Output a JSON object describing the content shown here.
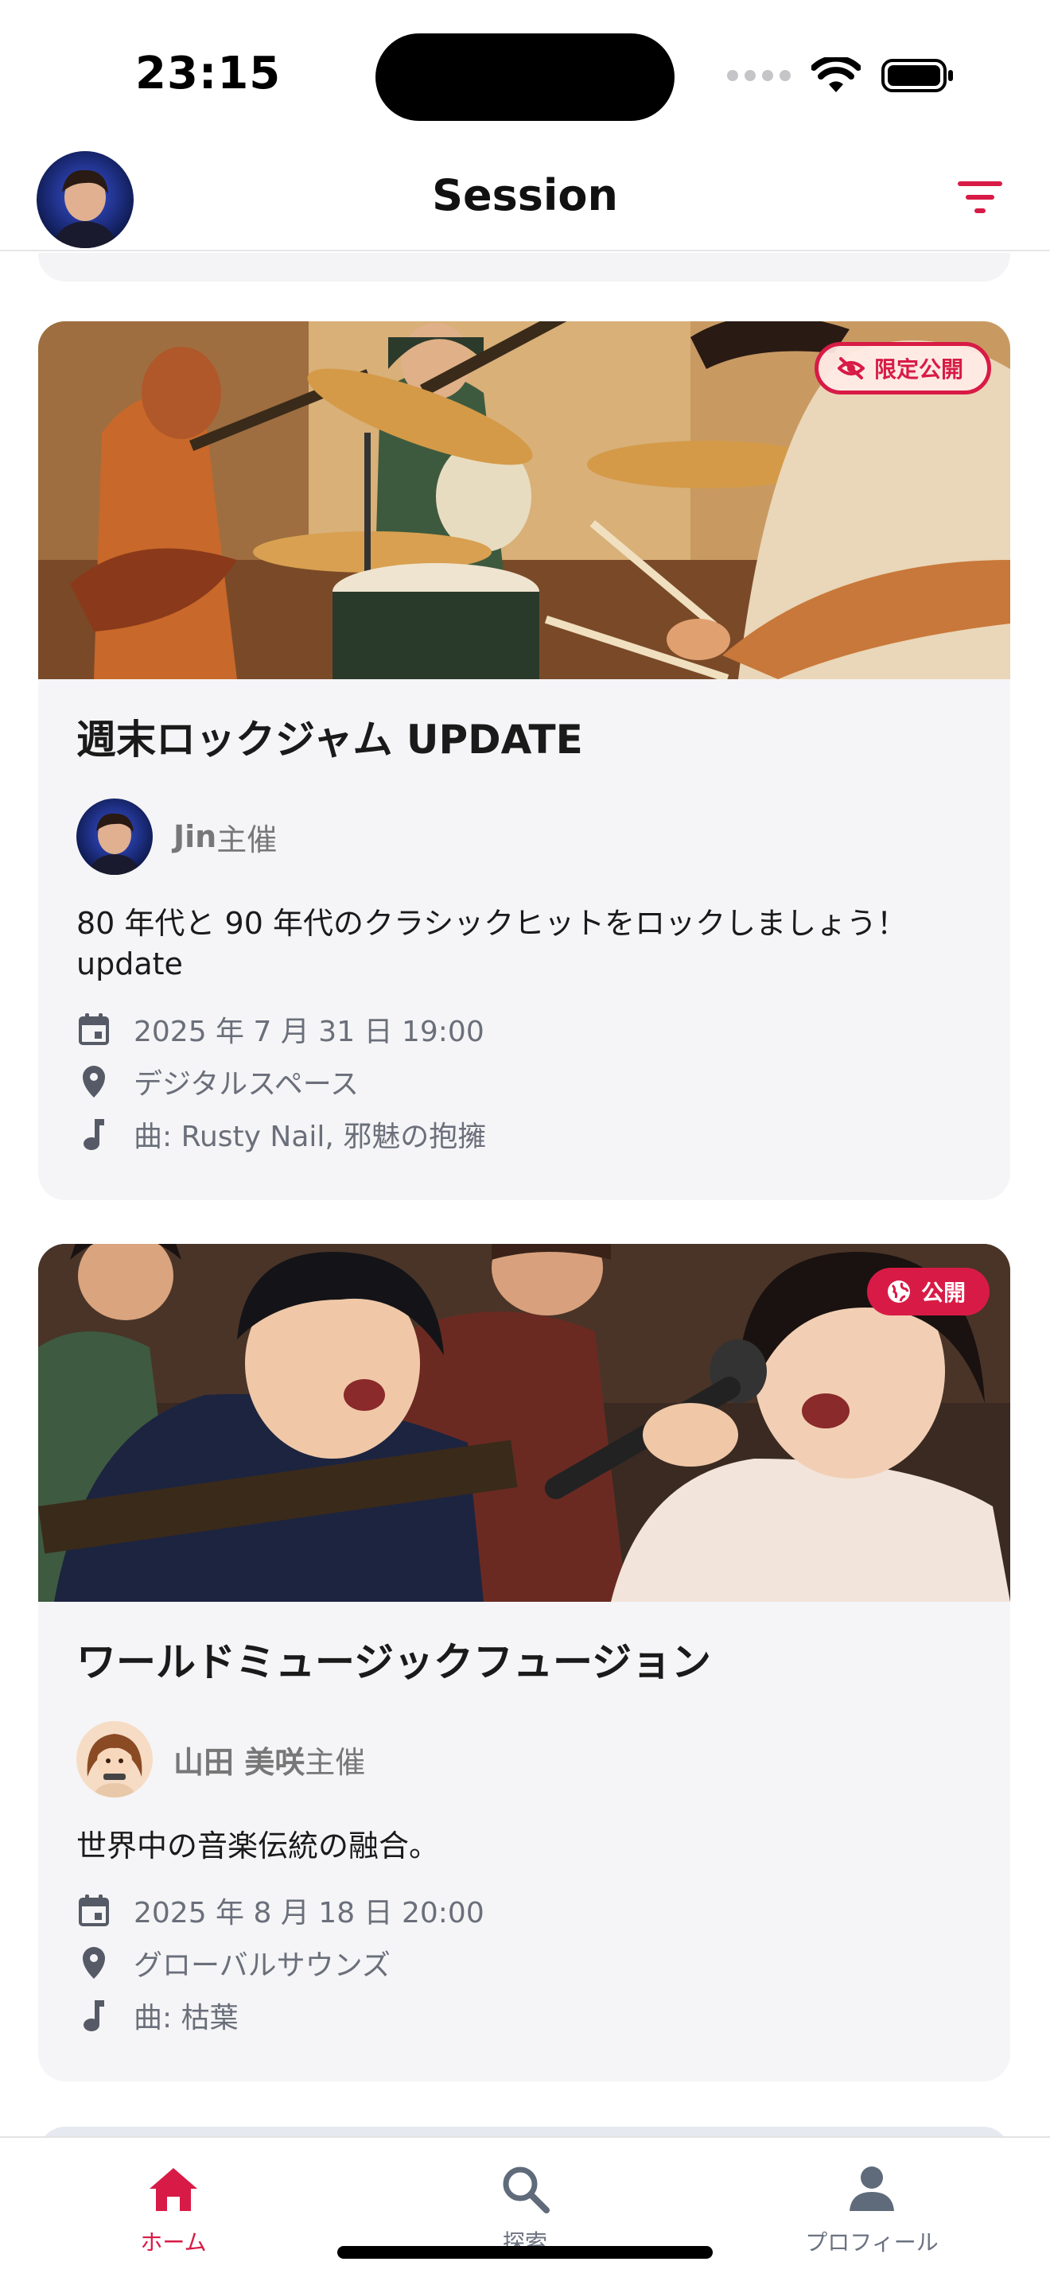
{
  "status_bar": {
    "time": "23:15"
  },
  "header": {
    "title": "Session"
  },
  "cards": [
    {
      "badge": "限定公開",
      "title": "週末ロックジャム UPDATE",
      "host_name": "Jin",
      "host_suffix": "主催",
      "description": "80 年代と 90 年代のクラシックヒットをロックしましょう！ update",
      "date": "2025 年 7 月 31 日 19:00",
      "location": "デジタルスペース",
      "songs": "曲: Rusty Nail, 邪魅の抱擁"
    },
    {
      "badge": "公開",
      "title": "ワールドミュージックフュージョン",
      "host_name": "山田 美咲",
      "host_suffix": "主催",
      "description": "世界中の音楽伝統の融合。",
      "date": "2025 年 8 月 18 日 20:00",
      "location": "グローバルサウンズ",
      "songs": "曲: 枯葉"
    }
  ],
  "nav": {
    "home": "ホーム",
    "explore": "探索",
    "profile": "プロフィール"
  },
  "colors": {
    "accent": "#d81b46",
    "card_bg": "#f5f5f7",
    "meta_text": "#6a6f7a"
  },
  "icons": {
    "filter": "filter-icon",
    "calendar": "calendar-icon",
    "location": "location-pin-icon",
    "music": "music-note-icon",
    "eye_off": "eye-off-icon",
    "globe": "globe-icon",
    "home": "home-icon",
    "search": "search-icon",
    "person": "person-icon"
  }
}
